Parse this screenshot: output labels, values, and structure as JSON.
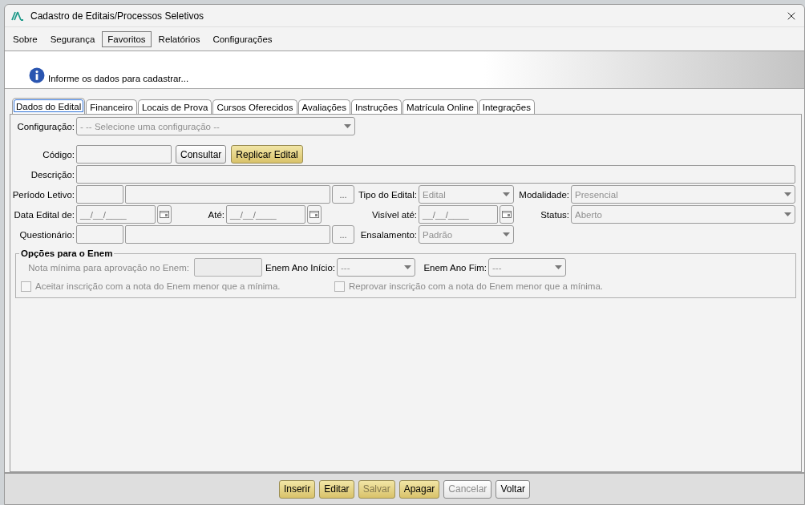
{
  "window": {
    "title": "Cadastro de Editais/Processos Seletivos"
  },
  "menu": [
    {
      "label": "Sobre",
      "selected": false
    },
    {
      "label": "Segurança",
      "selected": false
    },
    {
      "label": "Favoritos",
      "selected": true
    },
    {
      "label": "Relatórios",
      "selected": false
    },
    {
      "label": "Configurações",
      "selected": false
    }
  ],
  "info": {
    "message": "Informe os dados para cadastrar..."
  },
  "tabs": [
    {
      "label": "Dados do Edital",
      "selected": true
    },
    {
      "label": "Financeiro",
      "selected": false
    },
    {
      "label": "Locais de Prova",
      "selected": false
    },
    {
      "label": "Cursos Oferecidos",
      "selected": false
    },
    {
      "label": "Avaliações",
      "selected": false
    },
    {
      "label": "Instruções",
      "selected": false
    },
    {
      "label": "Matrícula Online",
      "selected": false
    },
    {
      "label": "Integrações",
      "selected": false
    }
  ],
  "form": {
    "configuracao": {
      "label": "Configuração:",
      "value": "- -- Selecione uma configuração --",
      "disabled": true
    },
    "codigo": {
      "label": "Código:"
    },
    "consultar": {
      "label": "Consultar",
      "kind": "plain",
      "disabled": false
    },
    "replicar": {
      "label": "Replicar Edital",
      "kind": "gold",
      "disabled": false
    },
    "descricao": {
      "label": "Descrição:"
    },
    "periodo": {
      "label": "Período Letivo:",
      "button": "..."
    },
    "tipo": {
      "label": "Tipo do Edital:",
      "value": "Edital",
      "disabled": true
    },
    "modalidade": {
      "label": "Modalidade:",
      "value": "Presencial",
      "disabled": true
    },
    "data_de": {
      "label": "Data Edital de:",
      "value": "__/__/____"
    },
    "ate": {
      "label": "Até:",
      "value": "__/__/____"
    },
    "visivel": {
      "label": "Visível até:",
      "value": "__/__/____"
    },
    "status": {
      "label": "Status:",
      "value": "Aberto",
      "disabled": true
    },
    "questionario": {
      "label": "Questionário:",
      "button": "..."
    },
    "ensalamento": {
      "label": "Ensalamento:",
      "value": "Padrão",
      "disabled": true
    }
  },
  "enem": {
    "title": "Opções para o Enem",
    "nota": {
      "label": "Nota mínima para aprovação no Enem:",
      "disabled": true
    },
    "ano_inicio": {
      "label": "Enem Ano Início:",
      "value": "---",
      "disabled": true
    },
    "ano_fim": {
      "label": "Enem Ano Fim:",
      "value": "---",
      "disabled": true
    },
    "checkboxes": [
      {
        "label": "Aceitar inscrição com a nota do Enem menor que a mínima.",
        "checked": false,
        "disabled": true
      },
      {
        "label": "Reprovar inscrição com a nota do Enem menor que a mínima.",
        "checked": false,
        "disabled": true
      }
    ]
  },
  "buttons": [
    {
      "label": "Inserir",
      "kind": "gold",
      "disabled": false
    },
    {
      "label": "Editar",
      "kind": "gold",
      "disabled": false
    },
    {
      "label": "Salvar",
      "kind": "gold",
      "disabled": true
    },
    {
      "label": "Apagar",
      "kind": "gold",
      "disabled": false
    },
    {
      "label": "Cancelar",
      "kind": "plain",
      "disabled": true
    },
    {
      "label": "Voltar",
      "kind": "plain",
      "disabled": false
    }
  ]
}
